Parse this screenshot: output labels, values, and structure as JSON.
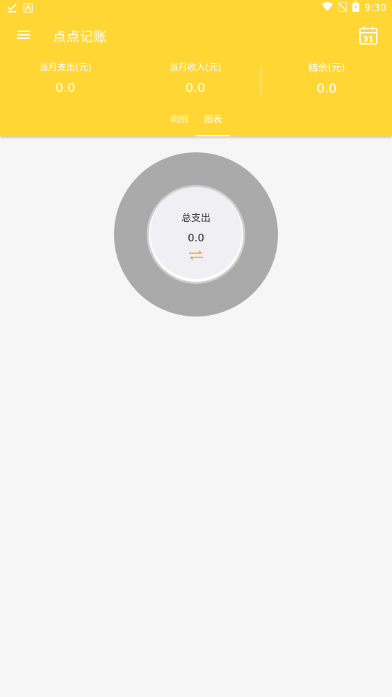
{
  "status_bar": {
    "time": "9:30",
    "left_icons": [
      "download-done-icon",
      "android-icon"
    ],
    "right_icons": [
      "wifi-icon",
      "no-sim-icon",
      "battery-charging-icon"
    ]
  },
  "app_bar": {
    "title": "点点记账",
    "menu_icon": "menu-icon",
    "calendar_icon": "calendar-icon",
    "calendar_day": "31"
  },
  "summary": {
    "expense_label": "当月支出(元)",
    "expense_value": "0.0",
    "income_label": "当月收入(元)",
    "income_value": "0.0",
    "balance_label": "结余(元)",
    "balance_value": "0.0"
  },
  "tabs": [
    {
      "label": "明细",
      "selected": false
    },
    {
      "label": "图表",
      "selected": true
    }
  ],
  "chart": {
    "center_label": "总支出",
    "center_value": "0.0",
    "switch_icon": "swap-icon"
  },
  "colors": {
    "header": "#ffd633",
    "background": "#f6f6f6",
    "donut_ring": "#aaaaaa",
    "center_fill": "#efeff4",
    "switch_icon": "#f0a020"
  },
  "chart_data": {
    "type": "pie",
    "title": "",
    "categories": [],
    "values": []
  }
}
